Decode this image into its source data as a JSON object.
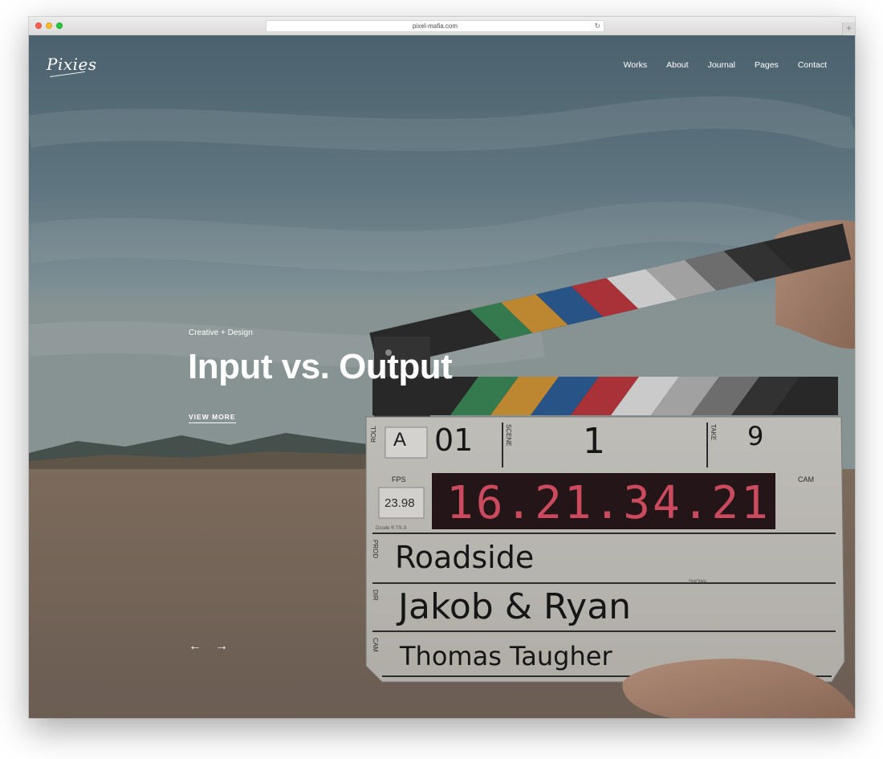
{
  "browser": {
    "url": "pixel-mafia.com",
    "reload_icon": "reload-icon",
    "new_tab_icon": "plus-icon",
    "new_tab_symbol": "+",
    "reload_symbol": "↻"
  },
  "header": {
    "logo_text": "Pixies",
    "nav": [
      {
        "label": "Works"
      },
      {
        "label": "About"
      },
      {
        "label": "Journal"
      },
      {
        "label": "Pages"
      },
      {
        "label": "Contact"
      }
    ]
  },
  "hero": {
    "eyebrow": "Creative + Design",
    "title": "Input vs. Output",
    "cta_label": "VIEW MORE",
    "prev_arrow": "←",
    "next_arrow": "→",
    "prev_icon": "arrow-left-icon",
    "next_icon": "arrow-right-icon"
  },
  "slate": {
    "roll_label": "ROLL",
    "roll_value": "A",
    "scene_label": "SCENE",
    "scene_prefix": "01",
    "scene_value": "1",
    "take_label": "TAKE",
    "take_value": "9",
    "fps_label": "FPS",
    "fps_value": "23.98",
    "timecode": "16.21.34.21",
    "cam_label": "CAM",
    "model_text": "Dcode ® TS-3",
    "prod_label": "PROD",
    "prod_value": "Roadside",
    "dir_label": "DIR",
    "dir_value": "Jakob & Ryan",
    "cam_row_label": "CAM",
    "cam_row_value": "Thomas Taugher",
    "show_label": "SHOW#"
  },
  "colors": {
    "stripe_colors": [
      "#3d8a5a",
      "#d89a3a",
      "#2e5f9a",
      "#c0393f",
      "#e6e6e6",
      "#b8b8b8",
      "#7d7d7d",
      "#3a3a3a"
    ],
    "timecode_color": "#e8556a"
  }
}
